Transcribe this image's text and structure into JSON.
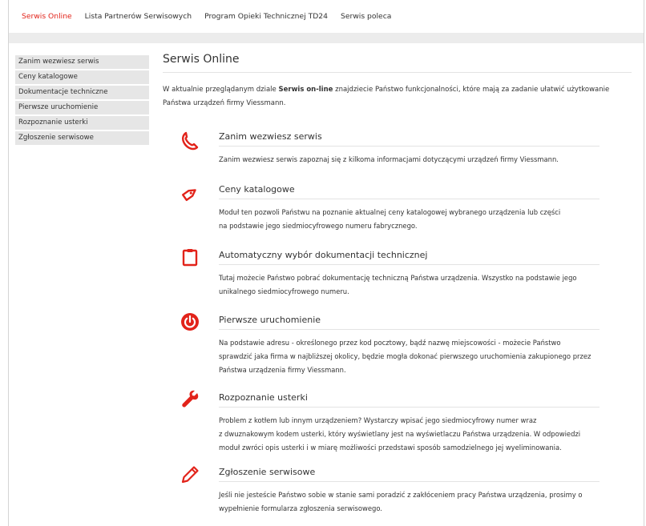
{
  "topnav": [
    {
      "label": "Serwis Online",
      "active": true
    },
    {
      "label": "Lista Partnerów Serwisowych",
      "active": false
    },
    {
      "label": "Program Opieki Technicznej TD24",
      "active": false
    },
    {
      "label": "Serwis poleca",
      "active": false
    }
  ],
  "sidebar": {
    "items": [
      {
        "label": "Zanim wezwiesz serwis"
      },
      {
        "label": "Ceny katalogowe"
      },
      {
        "label": "Dokumentacje techniczne"
      },
      {
        "label": "Pierwsze uruchomienie"
      },
      {
        "label": "Rozpoznanie usterki"
      },
      {
        "label": "Zgłoszenie serwisowe"
      }
    ]
  },
  "main": {
    "title": "Serwis Online",
    "intro_before": "W aktualnie przeglądanym dziale ",
    "intro_bold": "Serwis on-line",
    "intro_after": " znajdziecie Państwo funkcjonalności, które mają za zadanie ułatwić użytkowanie Państwa urządzeń firmy Viessmann.",
    "sections": [
      {
        "icon": "phone-icon",
        "title": "Zanim wezwiesz serwis",
        "lines": [
          "Zanim wezwiesz serwis zapoznaj się z kilkoma informacjami dotyczącymi urządzeń firmy Viessmann."
        ]
      },
      {
        "icon": "price-tag-icon",
        "title": "Ceny katalogowe",
        "lines": [
          "Moduł ten pozwoli Państwu na poznanie aktualnej ceny katalogowej wybranego urządzenia lub części",
          "na podstawie jego siedmiocyfrowego numeru fabrycznego."
        ]
      },
      {
        "icon": "clipboard-icon",
        "title": "Automatyczny wybór dokumentacji technicznej",
        "lines": [
          "Tutaj możecie Państwo pobrać dokumentację techniczną Państwa urządzenia. Wszystko na podstawie jego",
          "unikalnego siedmiocyfrowego numeru."
        ]
      },
      {
        "icon": "power-icon",
        "title": "Pierwsze uruchomienie",
        "lines": [
          "Na podstawie adresu - określonego przez kod pocztowy, bądź nazwę miejscowości - możecie Państwo",
          "sprawdzić jaka firma w najbliższej okolicy, będzie mogła dokonać pierwszego uruchomienia zakupionego przez",
          "Państwa urządzenia firmy Viessmann."
        ]
      },
      {
        "icon": "wrench-icon",
        "title": "Rozpoznanie usterki",
        "lines": [
          "Problem z kotłem lub innym urządzeniem? Wystarczy wpisać jego siedmiocyfrowy numer wraz",
          "z dwuznakowym kodem usterki, który wyświetlany jest na wyświetlaczu Państwa urządzenia. W odpowiedzi",
          "moduł zwróci opis usterki i w miarę możliwości przedstawi sposób samodzielnego jej wyeliminowania."
        ]
      },
      {
        "icon": "pencil-icon",
        "title": "Zgłoszenie serwisowe",
        "lines": [
          "Jeśli nie jesteście Państwo sobie w stanie sami poradzić z zakłóceniem pracy Państwa urządzenia, prosimy o",
          "wypełnienie formularza zgłoszenia serwisowego."
        ]
      }
    ]
  },
  "colors": {
    "accent": "#e2231a",
    "sidebar_bg": "#e6e6e6",
    "band_bg": "#ececec"
  }
}
